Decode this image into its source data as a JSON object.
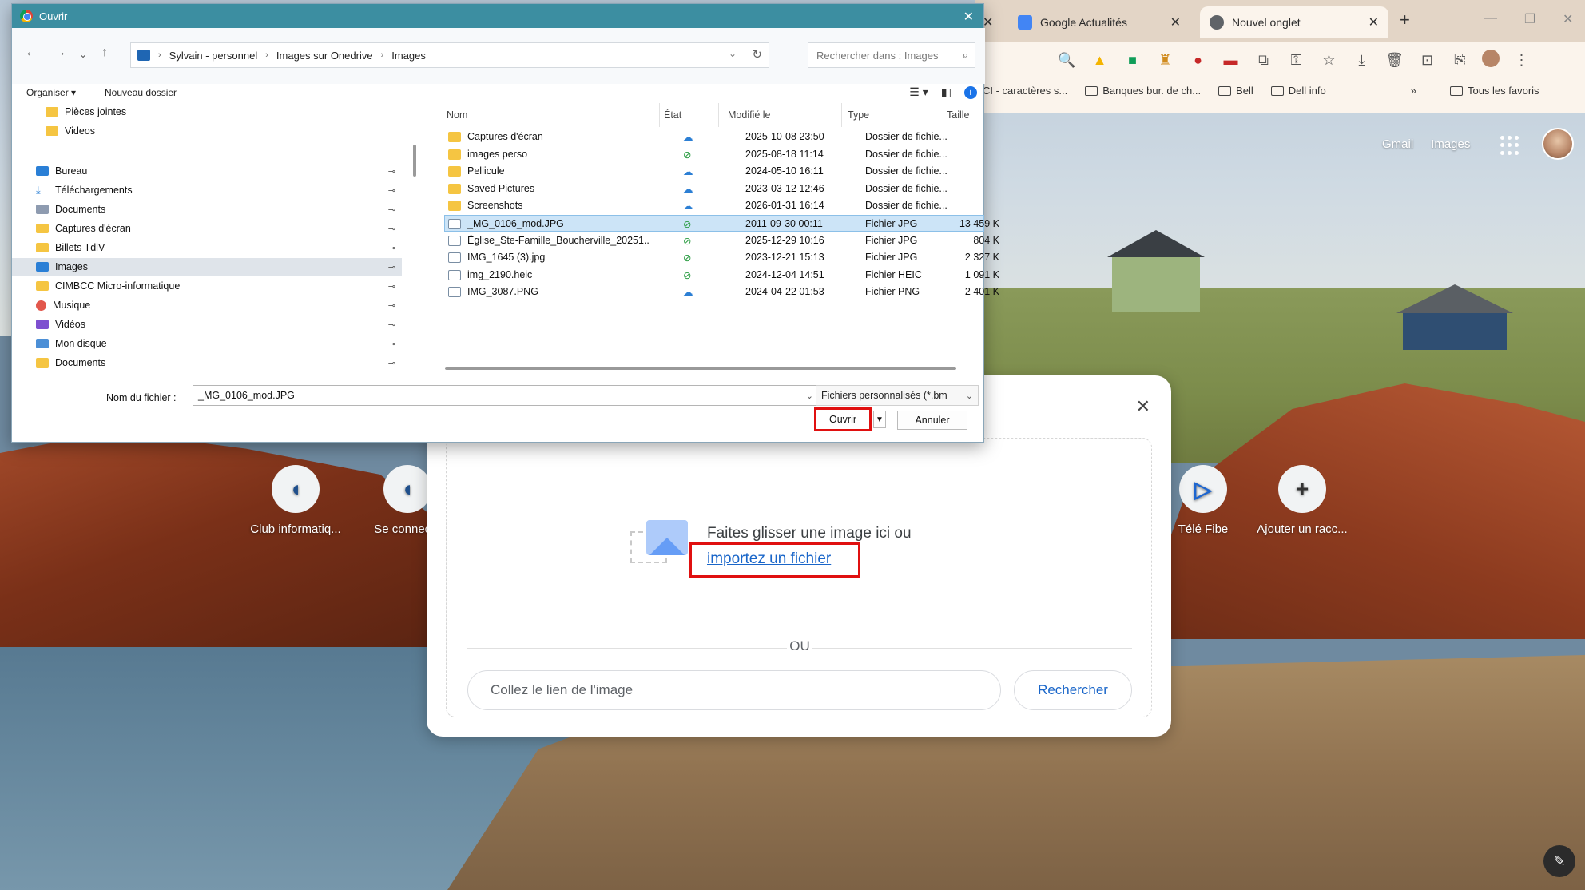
{
  "browser": {
    "tabs": [
      {
        "label": "Google Actualités"
      },
      {
        "label": "Nouvel onglet"
      }
    ],
    "bookmarks": [
      {
        "label": "CI - caractères s..."
      },
      {
        "label": "Banques bur. de ch..."
      },
      {
        "label": "Bell"
      },
      {
        "label": "Dell info"
      }
    ],
    "all_bookmarks": "Tous les favoris",
    "more_bookmarks": "»",
    "new_tab_symbol": "+",
    "header_links": {
      "gmail": "Gmail",
      "images": "Images"
    },
    "shortcuts": [
      {
        "label": "Club informatiq..."
      },
      {
        "label": "Se connecte"
      },
      {
        "label": "Télé Fibe"
      },
      {
        "label": "Ajouter un racc..."
      }
    ]
  },
  "lens": {
    "drag_text": "Faites glisser une image ici ou",
    "upload_link": "importez un fichier",
    "or_text": "OU",
    "url_placeholder": "Collez le lien de l'image",
    "search_button": "Rechercher"
  },
  "dialog": {
    "title": "Ouvrir",
    "breadcrumb": [
      "Sylvain - personnel",
      "Images sur Onedrive",
      "Images"
    ],
    "search_placeholder": "Rechercher dans : Images",
    "organize": "Organiser ▾",
    "new_folder": "Nouveau dossier",
    "nav_items": [
      {
        "label": "Pièces jointes",
        "icon": "folder-icon"
      },
      {
        "label": "Videos",
        "icon": "folder-icon"
      },
      {
        "label": "Bureau",
        "icon": "desktop-icon"
      },
      {
        "label": "Téléchargements",
        "icon": "download-icon"
      },
      {
        "label": "Documents",
        "icon": "document-icon"
      },
      {
        "label": "Captures d'écran",
        "icon": "folder-icon"
      },
      {
        "label": "Billets TdlV",
        "icon": "folder-icon"
      },
      {
        "label": "Images",
        "icon": "pictures-icon"
      },
      {
        "label": "CIMBCC Micro-informatique",
        "icon": "folder-icon"
      },
      {
        "label": "Musique",
        "icon": "music-icon"
      },
      {
        "label": "Vidéos",
        "icon": "video-icon"
      },
      {
        "label": "Mon disque",
        "icon": "drive-icon"
      },
      {
        "label": "Documents",
        "icon": "folder-icon"
      }
    ],
    "columns": {
      "name": "Nom",
      "state": "État",
      "modified": "Modifié le",
      "type": "Type",
      "size": "Taille"
    },
    "files": [
      {
        "name": "Captures d'écran",
        "state": "cloud",
        "modified": "2025-10-08 23:50",
        "type": "Dossier de fichie...",
        "size": "",
        "kind": "folder"
      },
      {
        "name": "images perso",
        "state": "ok",
        "modified": "2025-08-18 11:14",
        "type": "Dossier de fichie...",
        "size": "",
        "kind": "folder"
      },
      {
        "name": "Pellicule",
        "state": "cloud",
        "modified": "2024-05-10 16:11",
        "type": "Dossier de fichie...",
        "size": "",
        "kind": "folder"
      },
      {
        "name": "Saved Pictures",
        "state": "cloud",
        "modified": "2023-03-12 12:46",
        "type": "Dossier de fichie...",
        "size": "",
        "kind": "folder"
      },
      {
        "name": "Screenshots",
        "state": "cloud",
        "modified": "2026-01-31 16:14",
        "type": "Dossier de fichie...",
        "size": "",
        "kind": "folder"
      },
      {
        "name": "_MG_0106_mod.JPG",
        "state": "ok",
        "modified": "2011-09-30 00:11",
        "type": "Fichier JPG",
        "size": "13 459 K",
        "kind": "image"
      },
      {
        "name": "Église_Ste-Famille_Boucherville_20251...",
        "state": "ok",
        "modified": "2025-12-29 10:16",
        "type": "Fichier JPG",
        "size": "804 K",
        "kind": "image"
      },
      {
        "name": "IMG_1645 (3).jpg",
        "state": "ok",
        "modified": "2023-12-21 15:13",
        "type": "Fichier JPG",
        "size": "2 327 K",
        "kind": "image"
      },
      {
        "name": "img_2190.heic",
        "state": "ok",
        "modified": "2024-12-04 14:51",
        "type": "Fichier HEIC",
        "size": "1 091 K",
        "kind": "image"
      },
      {
        "name": "IMG_3087.PNG",
        "state": "cloud",
        "modified": "2024-04-22 01:53",
        "type": "Fichier PNG",
        "size": "2 401 K",
        "kind": "image"
      }
    ],
    "filename_label": "Nom du fichier :",
    "filename_value": "_MG_0106_mod.JPG",
    "filetype_value": "Fichiers personnalisés (*.bm",
    "open_button": "Ouvrir",
    "cancel_button": "Annuler"
  },
  "colors": {
    "title_bar": "#3c8ea1",
    "selection": "#cce4f7",
    "highlight_box": "#e01010",
    "link": "#1a66c9"
  }
}
